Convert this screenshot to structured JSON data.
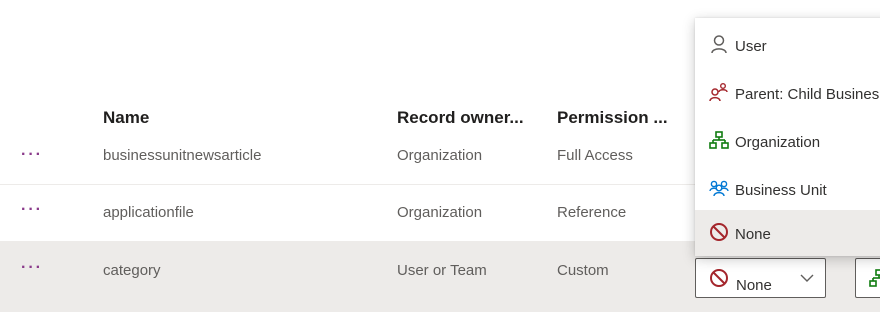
{
  "table": {
    "columns": {
      "name": "Name",
      "owner": "Record owner...",
      "permission": "Permission ..."
    },
    "rows": [
      {
        "menu": "···",
        "name": "businessunitnewsarticle",
        "owner": "Organization",
        "permission": "Full Access"
      },
      {
        "menu": "···",
        "name": "applicationfile",
        "owner": "Organization",
        "permission": "Reference"
      },
      {
        "menu": "···",
        "name": "category",
        "owner": "User or Team",
        "permission": "Custom"
      }
    ]
  },
  "dropdown": {
    "items": [
      {
        "label": "User",
        "icon": "user-icon"
      },
      {
        "label": "Parent: Child Busines",
        "icon": "parent-child-icon"
      },
      {
        "label": "Organization",
        "icon": "organization-icon"
      },
      {
        "label": "Business Unit",
        "icon": "business-unit-icon"
      },
      {
        "label": "None",
        "icon": "none-icon",
        "selected": true
      }
    ],
    "selected_value": "None"
  },
  "colors": {
    "accent_red": "#a4262c",
    "org_green": "#107c10",
    "bu_blue": "#0078d4",
    "row_selected": "#edebe9"
  }
}
